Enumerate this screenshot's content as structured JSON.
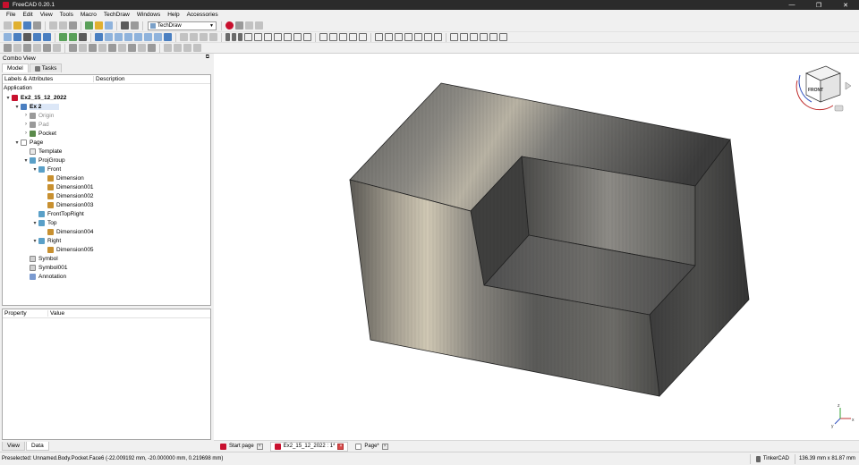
{
  "window": {
    "title": "FreeCAD 0.20.1",
    "controls": [
      "—",
      "❐",
      "✕"
    ]
  },
  "menu": [
    "File",
    "Edit",
    "View",
    "Tools",
    "Macro",
    "TechDraw",
    "Windows",
    "Help",
    "Accessories"
  ],
  "toolbar": {
    "workbench": "TechDraw"
  },
  "combo_view": {
    "title": "Combo View",
    "tabs": [
      "Model",
      "Tasks"
    ],
    "tree_columns": [
      "Labels & Attributes",
      "Description"
    ],
    "tree_root": "Application",
    "tree": [
      {
        "label": "Ex2_15_12_2022",
        "level": 0,
        "expander": "▾",
        "icon": "document-icon",
        "bold": true
      },
      {
        "label": "Ex 2",
        "level": 1,
        "expander": "▾",
        "icon": "body-icon",
        "bold": true,
        "selected": true
      },
      {
        "label": "Origin",
        "level": 2,
        "expander": "›",
        "icon": "origin-icon",
        "dim": true
      },
      {
        "label": "Pad",
        "level": 2,
        "expander": "›",
        "icon": "pad-icon",
        "dim": true
      },
      {
        "label": "Pocket",
        "level": 2,
        "expander": "›",
        "icon": "pocket-icon"
      },
      {
        "label": "Page",
        "level": 1,
        "expander": "▾",
        "icon": "page-icon"
      },
      {
        "label": "Template",
        "level": 2,
        "expander": "",
        "icon": "template-icon"
      },
      {
        "label": "ProjGroup",
        "level": 2,
        "expander": "▾",
        "icon": "projgroup-icon"
      },
      {
        "label": "Front",
        "level": 3,
        "expander": "▾",
        "icon": "view-icon"
      },
      {
        "label": "Dimension",
        "level": 4,
        "expander": "",
        "icon": "horizontal-dimension-icon"
      },
      {
        "label": "Dimension001",
        "level": 4,
        "expander": "",
        "icon": "horizontal-dimension-icon"
      },
      {
        "label": "Dimension002",
        "level": 4,
        "expander": "",
        "icon": "vertical-dimension-icon"
      },
      {
        "label": "Dimension003",
        "level": 4,
        "expander": "",
        "icon": "vertical-dimension-icon"
      },
      {
        "label": "FrontTopRight",
        "level": 3,
        "expander": "",
        "icon": "view-icon"
      },
      {
        "label": "Top",
        "level": 3,
        "expander": "▾",
        "icon": "view-icon"
      },
      {
        "label": "Dimension004",
        "level": 4,
        "expander": "",
        "icon": "vertical-dimension-icon"
      },
      {
        "label": "Right",
        "level": 3,
        "expander": "▾",
        "icon": "view-icon"
      },
      {
        "label": "Dimension005",
        "level": 4,
        "expander": "",
        "icon": "horizontal-dimension-icon"
      },
      {
        "label": "Symbol",
        "level": 2,
        "expander": "",
        "icon": "symbol-icon"
      },
      {
        "label": "Symbol001",
        "level": 2,
        "expander": "",
        "icon": "symbol-icon"
      },
      {
        "label": "Annotation",
        "level": 2,
        "expander": "",
        "icon": "annotation-icon"
      }
    ],
    "property_columns": [
      "Property",
      "Value"
    ],
    "bottom_tabs": [
      "View",
      "Data"
    ]
  },
  "viewport": {
    "navcube_face": "FRONT"
  },
  "document_tabs": [
    {
      "label": "Start page",
      "icon": "freecad-icon",
      "active": false
    },
    {
      "label": "Ex2_15_12_2022 : 1*",
      "icon": "freecad-icon",
      "active": true
    },
    {
      "label": "Page*",
      "icon": "page-icon",
      "active": false
    }
  ],
  "status": {
    "message": "Preselected: Unnamed.Body.Pocket.Face6 (-22.009192 mm, -20.000000 mm, 0.219698 mm)",
    "navigation_style": "TinkerCAD",
    "dimensions": "136.39 mm x 81.87 mm"
  }
}
